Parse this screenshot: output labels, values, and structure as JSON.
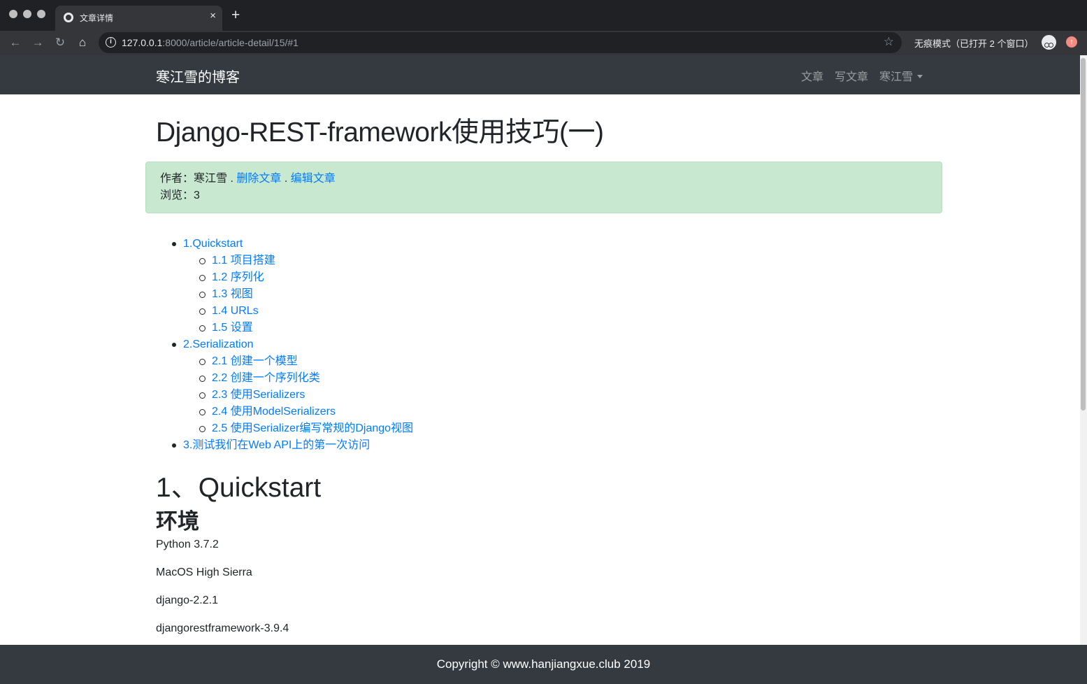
{
  "browser": {
    "tab_title": "文章详情",
    "tab_close": "×",
    "new_tab": "+",
    "url_host": "127.0.0.1",
    "url_path": ":8000/article/article-detail/15/#1",
    "incognito_label": "无痕模式（已打开 2 个窗口）",
    "nav_icons": [
      "back-icon",
      "forward-icon",
      "reload-icon",
      "home-icon",
      "info-icon",
      "star-icon",
      "incognito-icon",
      "update-icon"
    ]
  },
  "navbar": {
    "brand": "寒江雪的博客",
    "links": [
      "文章",
      "写文章",
      "寒江雪"
    ]
  },
  "article": {
    "title": "Django-REST-framework使用技巧(一)",
    "meta": {
      "author_label": "作者：",
      "author": "寒江雪",
      "sep": " . ",
      "delete_link": "删除文章",
      "edit_link": "编辑文章",
      "views_label": "浏览：",
      "views": "3"
    },
    "toc": [
      {
        "label": "1.Quickstart",
        "children": [
          "1.1 项目搭建",
          "1.2 序列化",
          "1.3 视图",
          "1.4 URLs",
          "1.5 设置"
        ]
      },
      {
        "label": "2.Serialization",
        "children": [
          "2.1 创建一个模型",
          "2.2 创建一个序列化类",
          "2.3 使用Serializers",
          "2.4 使用ModelSerializers",
          "2.5 使用Serializer编写常规的Django视图"
        ]
      },
      {
        "label": "3.测试我们在Web API上的第一次访问",
        "children": []
      }
    ],
    "heading_1": "1、Quickstart",
    "heading_2": "环境",
    "paragraphs": [
      "Python 3.7.2",
      "MacOS High Sierra",
      "django-2.2.1",
      "djangorestframework-3.9.4"
    ]
  },
  "footer": {
    "text": "Copyright © www.hanjiangxue.club 2019"
  }
}
